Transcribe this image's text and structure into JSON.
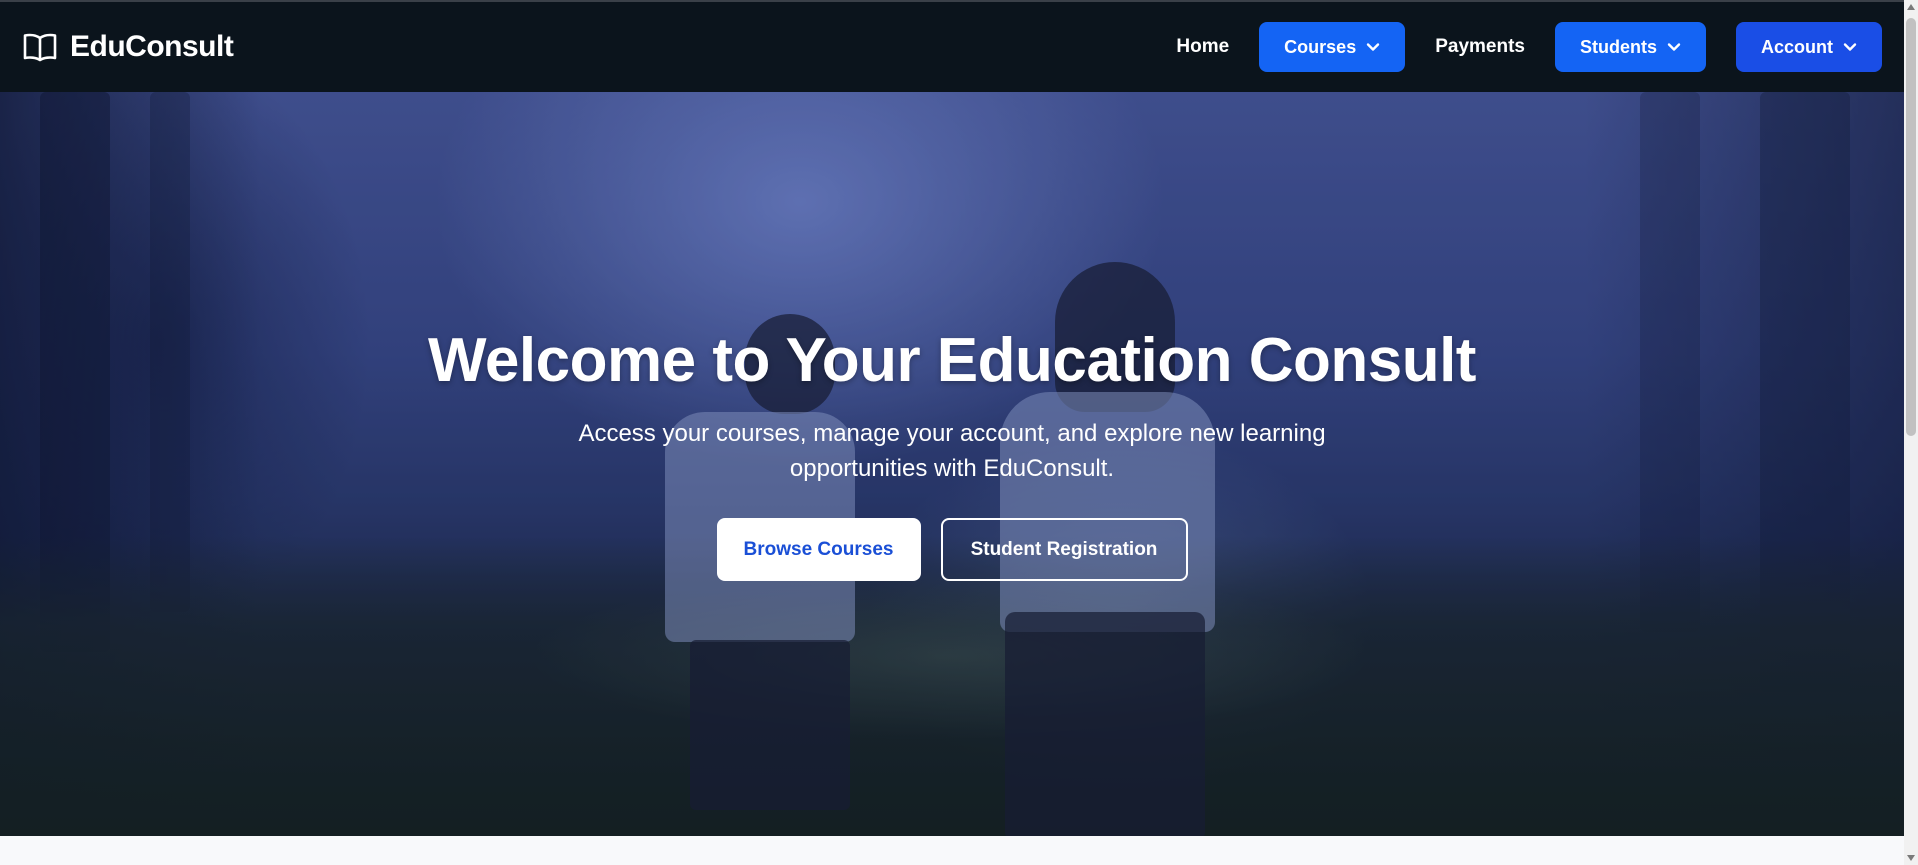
{
  "brand": {
    "name": "EduConsult",
    "icon": "open-book-icon"
  },
  "nav": {
    "home": "Home",
    "courses": "Courses",
    "payments": "Payments",
    "students": "Students",
    "account": "Account",
    "dropdown_icon": "chevron-down-icon"
  },
  "hero": {
    "title": "Welcome to Your Education Consult",
    "subtitle": "Access your courses, manage your account, and explore new learning opportunities with EduConsult.",
    "primary_button": "Browse Courses",
    "secondary_button": "Student Registration"
  },
  "colors": {
    "navbar_bg": "#0b141c",
    "accent_blue": "#1464f4",
    "account_blue": "#1a4ee6",
    "primary_button_text": "#1a4fd6"
  },
  "scroll": {
    "thumb_fraction": 0.5
  }
}
